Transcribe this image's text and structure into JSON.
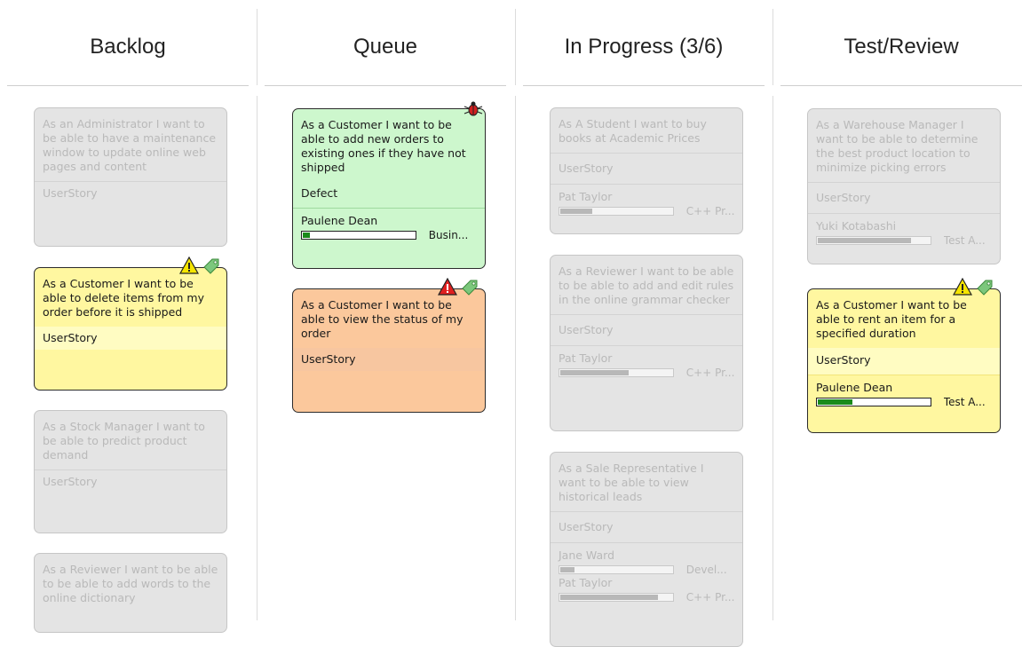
{
  "columns": [
    {
      "title": "Backlog"
    },
    {
      "title": "Queue"
    },
    {
      "title": "In Progress (3/6)"
    },
    {
      "title": "Test/Review"
    }
  ],
  "backlog": [
    {
      "title": "As an Administrator I want to be able to have a maintenance window to update online web pages and content",
      "type": "UserStory"
    },
    {
      "title": "As a Customer I want to be able to delete items from my order before it is shipped",
      "type": "UserStory",
      "icons": [
        "warning-icon",
        "tag-icon"
      ]
    },
    {
      "title": "As a Stock Manager I want to be able to predict product demand",
      "type": "UserStory"
    },
    {
      "title": "As a Reviewer I want to be able to be able to add words to the online dictionary"
    }
  ],
  "queue": [
    {
      "title": "As a Customer I want to be able to add new orders to existing ones if they have not shipped",
      "type": "Defect",
      "resource": "Paulene Dean",
      "progress": 0.08,
      "role": "Busin...",
      "icons": [
        "bug-icon"
      ]
    },
    {
      "title": "As a Customer I want to be able to view the status of my order",
      "type": "UserStory",
      "icons": [
        "error-icon",
        "tag-icon"
      ]
    }
  ],
  "in_progress": [
    {
      "title": "As A Student I want to buy books at Academic Prices",
      "type": "UserStory",
      "resource": "Pat Taylor",
      "progress": 0.3,
      "role": "C++ Pr..."
    },
    {
      "title": "As a Reviewer I want to be able to be able to add and edit rules in the online grammar checker",
      "type": "UserStory",
      "resource": "Pat Taylor",
      "progress": 0.62,
      "role": "C++ Pr..."
    },
    {
      "title": "As a Sale Representative I want to be able to view historical leads",
      "type": "UserStory",
      "resources": [
        {
          "name": "Jane Ward",
          "progress": 0.14,
          "role": "Devel..."
        },
        {
          "name": "Pat Taylor",
          "progress": 0.88,
          "role": "C++ Pr..."
        }
      ]
    }
  ],
  "test_review": [
    {
      "title": "As a Warehouse Manager I want to be able to determine the best product location to minimize picking errors",
      "type": "UserStory",
      "resource": "Yuki Kotabashi",
      "progress": 0.84,
      "role": "Test A..."
    },
    {
      "title": "As a Customer I want to be able to rent an item for a specified duration",
      "type": "UserStory",
      "resource": "Paulene Dean",
      "progress": 0.32,
      "role": "Test A...",
      "icons": [
        "warning-icon",
        "tag-icon"
      ]
    }
  ]
}
